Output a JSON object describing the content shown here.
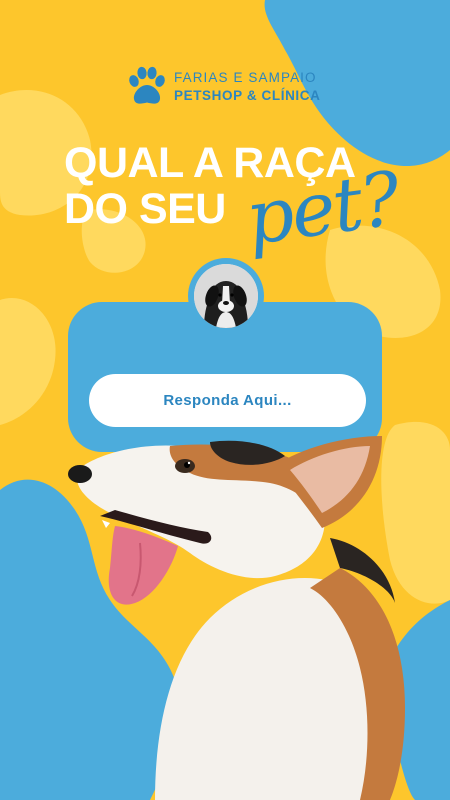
{
  "brand": {
    "icon": "paw-icon",
    "name_line1": "FARIAS E SAMPAIO",
    "name_line2": "PETSHOP & CLÍNICA"
  },
  "headline": {
    "line1": "QUAL A RAÇA",
    "line2": "DO SEU",
    "script_word": "pet?"
  },
  "question_card": {
    "avatar_description": "black-white-dog-photo",
    "answer_button_label": "Responda Aqui..."
  },
  "colors": {
    "background_yellow": "#FDC62C",
    "accent_blue": "#4CACDC",
    "text_blue": "#2C86C0",
    "light_blob": "#FFD95E",
    "white": "#FFFFFF"
  }
}
